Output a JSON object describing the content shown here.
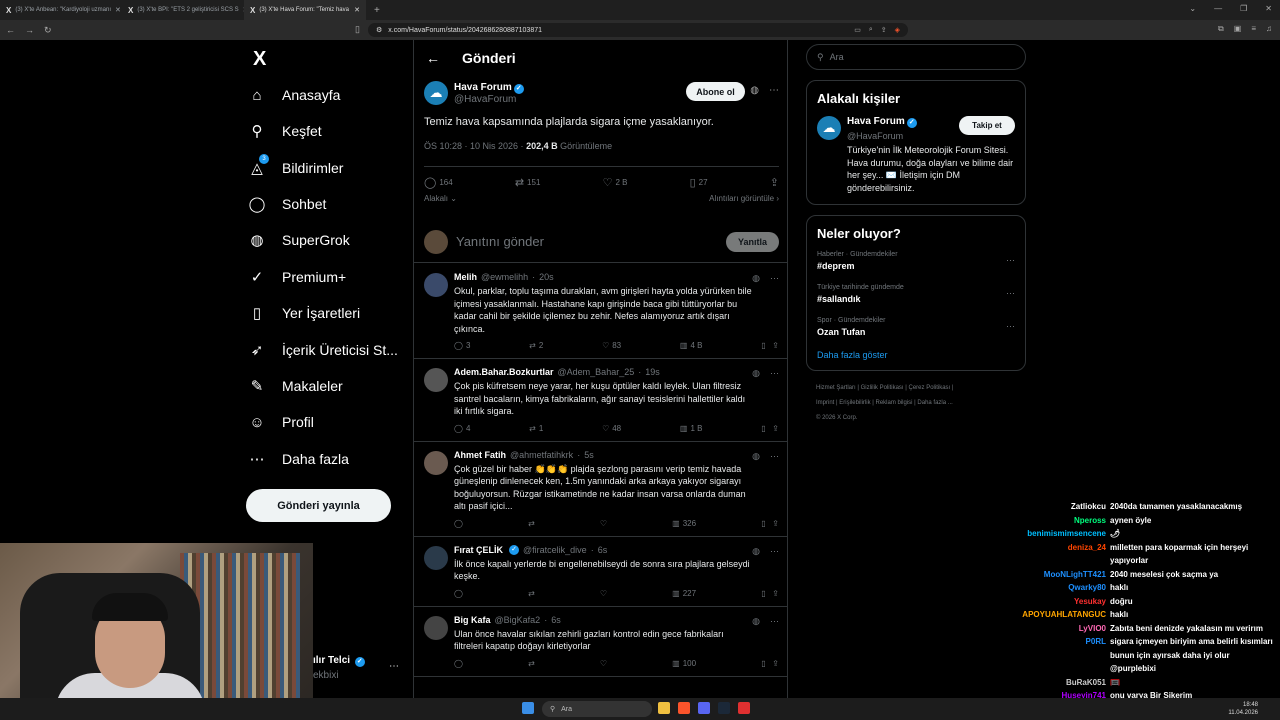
{
  "browser": {
    "tabs": [
      {
        "label": "(3) X'te Anbean: \"Kardiyoloji uzmanı"
      },
      {
        "label": "(3) X'te BPI: \"ETS 2 geliştiricisi SCS S"
      },
      {
        "label": "(3) X'te Hava Forum: \"Temiz hava"
      }
    ],
    "url": "x.com/HavaForum/status/2042686280887103871"
  },
  "nav": {
    "logo": "X",
    "items": [
      {
        "label": "Anasayfa",
        "icon": "home-icon",
        "glyph": "⌂"
      },
      {
        "label": "Keşfet",
        "icon": "search-icon",
        "glyph": "⚲"
      },
      {
        "label": "Bildirimler",
        "icon": "bell-icon",
        "glyph": "🔔",
        "badge": "3"
      },
      {
        "label": "Sohbet",
        "icon": "chat-icon",
        "glyph": "◯"
      },
      {
        "label": "SuperGrok",
        "icon": "grok-icon",
        "glyph": "◍"
      },
      {
        "label": "Premium+",
        "icon": "premium-icon",
        "glyph": "✓"
      },
      {
        "label": "Yer İşaretleri",
        "icon": "bookmark-icon",
        "glyph": "▯"
      },
      {
        "label": "İçerik Üreticisi St...",
        "icon": "rocket-icon",
        "glyph": "➶"
      },
      {
        "label": "Makaleler",
        "icon": "article-icon",
        "glyph": "✎"
      },
      {
        "label": "Profil",
        "icon": "profile-icon",
        "glyph": "☺"
      },
      {
        "label": "Daha fazla",
        "icon": "more-icon",
        "glyph": "⋯"
      }
    ],
    "post_button": "Gönderi yayınla",
    "account": {
      "name": "ılır Telci",
      "handle": "ekbixi"
    }
  },
  "main": {
    "header_title": "Gönderi",
    "post": {
      "author": "Hava Forum",
      "handle": "@HavaForum",
      "subscribe": "Abone ol",
      "text": "Temiz hava kapsamında plajlarda sigara içme yasaklanıyor.",
      "time": "ÖS 10:28 · 10 Nis 2026 · ",
      "views": "202,4 B",
      "views_label": " Görüntüleme",
      "replies": "164",
      "reposts": "151",
      "likes": "2 B",
      "bookmarks": "27",
      "filter_left": "Alakalı",
      "filter_right": "Alıntıları görüntüle"
    },
    "reply_box": {
      "placeholder": "Yanıtını gönder",
      "button": "Yanıtla"
    },
    "tweets": [
      {
        "name": "Melih",
        "handle": "@ewmelihh",
        "time": "20s",
        "avatar": "#3a4a6a",
        "text": "Okul, parklar, toplu taşıma durakları, avm girişleri hayta yolda yürürken bile içimesi yasaklanmalı. Hastahane kapı girişinde baca gibi tüttüryorlar bu kadar cahil bir şekilde içilemez bu zehir. Nefes alamıyoruz artık dışarı çıkınca.",
        "replies": "3",
        "reposts": "2",
        "likes": "83",
        "views": "4 B"
      },
      {
        "name": "Adem.Bahar.Bozkurtlar",
        "handle": "@Adem_Bahar_25",
        "time": "19s",
        "avatar": "#555555",
        "text": "Çok pis küfretsem neye yarar, her kuşu öptüler kaldı leylek. Ulan filtresiz santrel bacaların, kimya fabrikaların, ağır sanayi tesislerini hallettiler kaldı iki fırtlık sigara.",
        "replies": "4",
        "reposts": "1",
        "likes": "48",
        "views": "1 B"
      },
      {
        "name": "Ahmet Fatih",
        "handle": "@ahmetfatihkrk",
        "time": "5s",
        "avatar": "#6a5a50",
        "text": "Çok güzel bir haber 👏👏👏 plajda şezlong parasını verip temiz havada güneşlenip dinlenecek ken, 1.5m yanındaki arka arkaya yakıyor sigarayı boğuluyorsun. Rüzgar istikametinde ne kadar insan varsa onlarda duman altı pasif içici...",
        "replies": "",
        "reposts": "",
        "likes": "",
        "views": "326"
      },
      {
        "name": "Fırat ÇELİK",
        "handle": "@firatcelik_dive",
        "time": "6s",
        "avatar": "#2a3a4a",
        "verified": true,
        "text": "İlk önce kapalı yerlerde bi engellenebilseydi de sonra sıra plajlara gelseydi keşke.",
        "replies": "",
        "reposts": "",
        "likes": "",
        "views": "227"
      },
      {
        "name": "Big Kafa",
        "handle": "@BigKafa2",
        "time": "6s",
        "avatar": "#444444",
        "text": "Ulan önce havalar sıkılan zehirli gazları kontrol edin gece fabrikaları filtreleri kapatıp doğayı kirletiyorlar",
        "replies": "",
        "reposts": "",
        "likes": "",
        "views": "100"
      }
    ]
  },
  "right": {
    "search_placeholder": "Ara",
    "related_title": "Alakalı kişiler",
    "related": {
      "name": "Hava Forum",
      "handle": "@HavaForum",
      "follow": "Takip et",
      "bio": "Türkiye'nin İlk Meteorolojik Forum Sitesi. Hava durumu, doğa olayları ve bilime dair her şey... ✉️ İletişim için DM gönderebilirsiniz."
    },
    "trends_title": "Neler oluyor?",
    "trends": [
      {
        "category": "Haberler · Gündemdekiler",
        "label": "#deprem"
      },
      {
        "category": "Türkiye tarihinde gündemde",
        "label": "#sallandık"
      },
      {
        "category": "Spor · Gündemdekiler",
        "label": "Ozan Tufan"
      }
    ],
    "show_more": "Daha fazla göster",
    "footer": [
      "Hizmet Şartları",
      "Gizlilik Politikası",
      "Çerez Politikası",
      "Imprint",
      "Erişilebilirlik",
      "Reklam bilgisi",
      "Daha fazla ...",
      "© 2026 X Corp."
    ]
  },
  "chat": [
    {
      "user": "Zatliokcu",
      "color": "#ffffff",
      "msg": "2040da tamamen yasaklanacakmış"
    },
    {
      "user": "Npeross",
      "color": "#00ff7f",
      "msg": "aynen öyle"
    },
    {
      "user": "benimismimsencene",
      "color": "#00bfff",
      "msg": "🌶"
    },
    {
      "user": "deniza_24",
      "color": "#ff4500",
      "msg": "milletten para koparmak için herşeyi yapıyorlar"
    },
    {
      "user": "MooNLighTT421",
      "color": "#1e90ff",
      "msg": "2040 meselesi çok saçma ya"
    },
    {
      "user": "Qwarky80",
      "color": "#1e90ff",
      "msg": "haklı"
    },
    {
      "user": "Yesukay",
      "color": "#ff3030",
      "msg": "doğru"
    },
    {
      "user": "APOYUAHLATANGUC",
      "color": "#ffa500",
      "msg": "haklı"
    },
    {
      "user": "LyVIO0",
      "color": "#ff69b4",
      "msg": "Zabıta beni denizde yakalasın mı verirım"
    },
    {
      "user": "P0RL",
      "color": "#1e90ff",
      "msg": "sigara içmeyen biriyim ama belirli kısımları bunun için ayırsak daha iyi olur @purplebixi"
    },
    {
      "user": "BuRaK051",
      "color": "#cccccc",
      "msg": "🥅"
    },
    {
      "user": "Huseyin741",
      "color": "#b000ff",
      "msg": "onu varya Bir Sikerim"
    }
  ],
  "taskbar": {
    "search": "Ara",
    "time": "18:48",
    "date": "11.04.2026"
  }
}
